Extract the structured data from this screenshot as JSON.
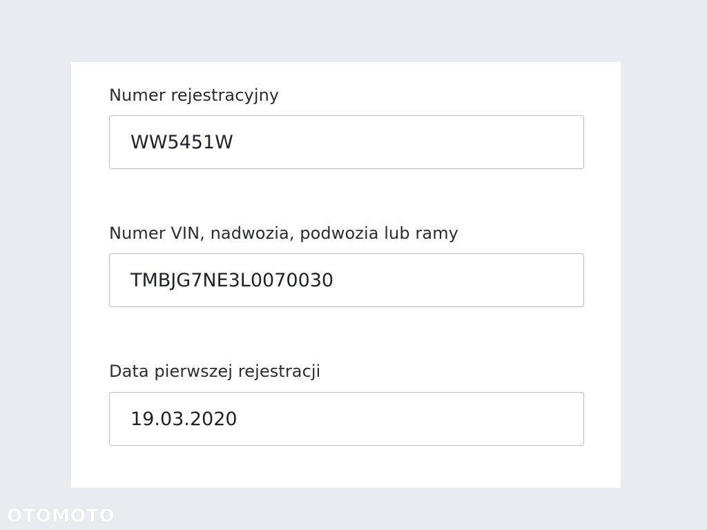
{
  "form": {
    "registration_number": {
      "label": "Numer rejestracyjny",
      "value": "WW5451W"
    },
    "vin": {
      "label": "Numer VIN, nadwozia, podwozia lub ramy",
      "value": "TMBJG7NE3L0070030"
    },
    "first_registration_date": {
      "label": "Data pierwszej rejestracji",
      "value": "19.03.2020"
    }
  },
  "watermark": {
    "text": "OTOMOTO"
  },
  "colors": {
    "page_background": "#e8ebef",
    "card_background": "#ffffff",
    "input_border": "#b9bcc3",
    "text": "#2a2c30"
  }
}
